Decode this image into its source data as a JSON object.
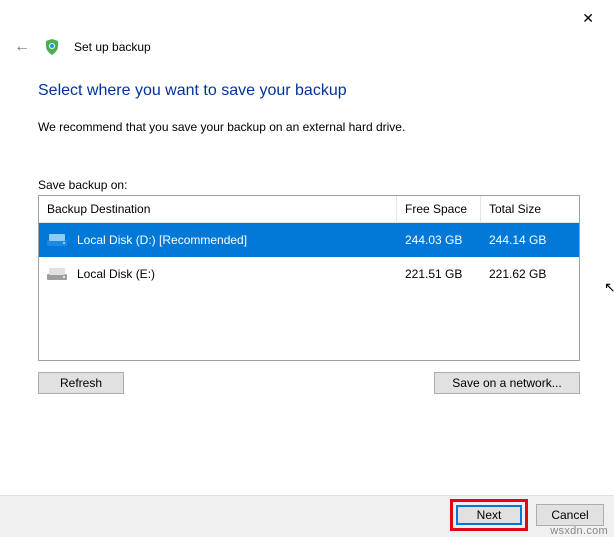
{
  "window": {
    "title": "Set up backup"
  },
  "main": {
    "title": "Select where you want to save your backup",
    "recommend": "We recommend that you save your backup on an external hard drive.",
    "save_label": "Save backup on:"
  },
  "table": {
    "headers": {
      "dest": "Backup Destination",
      "free": "Free Space",
      "total": "Total Size"
    },
    "rows": [
      {
        "name": "Local Disk (D:) [Recommended]",
        "free": "244.03 GB",
        "total": "244.14 GB",
        "selected": true
      },
      {
        "name": "Local Disk (E:)",
        "free": "221.51 GB",
        "total": "221.62 GB",
        "selected": false
      }
    ]
  },
  "buttons": {
    "refresh": "Refresh",
    "network": "Save on a network...",
    "next": "Next",
    "cancel": "Cancel"
  },
  "watermark": "wsxdn.com"
}
